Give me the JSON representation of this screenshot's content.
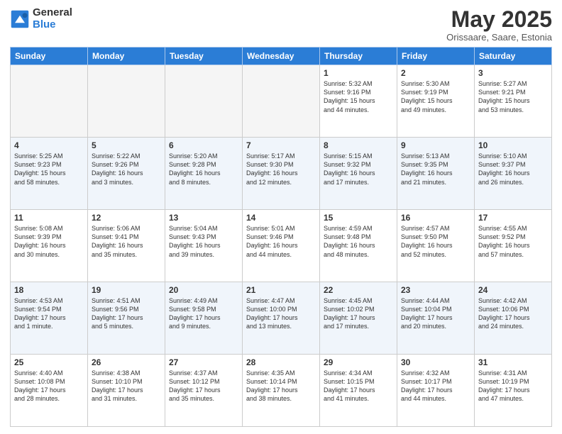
{
  "logo": {
    "general": "General",
    "blue": "Blue"
  },
  "title": "May 2025",
  "subtitle": "Orissaare, Saare, Estonia",
  "headers": [
    "Sunday",
    "Monday",
    "Tuesday",
    "Wednesday",
    "Thursday",
    "Friday",
    "Saturday"
  ],
  "weeks": [
    [
      {
        "day": "",
        "info": ""
      },
      {
        "day": "",
        "info": ""
      },
      {
        "day": "",
        "info": ""
      },
      {
        "day": "",
        "info": ""
      },
      {
        "day": "1",
        "info": "Sunrise: 5:32 AM\nSunset: 9:16 PM\nDaylight: 15 hours\nand 44 minutes."
      },
      {
        "day": "2",
        "info": "Sunrise: 5:30 AM\nSunset: 9:19 PM\nDaylight: 15 hours\nand 49 minutes."
      },
      {
        "day": "3",
        "info": "Sunrise: 5:27 AM\nSunset: 9:21 PM\nDaylight: 15 hours\nand 53 minutes."
      }
    ],
    [
      {
        "day": "4",
        "info": "Sunrise: 5:25 AM\nSunset: 9:23 PM\nDaylight: 15 hours\nand 58 minutes."
      },
      {
        "day": "5",
        "info": "Sunrise: 5:22 AM\nSunset: 9:26 PM\nDaylight: 16 hours\nand 3 minutes."
      },
      {
        "day": "6",
        "info": "Sunrise: 5:20 AM\nSunset: 9:28 PM\nDaylight: 16 hours\nand 8 minutes."
      },
      {
        "day": "7",
        "info": "Sunrise: 5:17 AM\nSunset: 9:30 PM\nDaylight: 16 hours\nand 12 minutes."
      },
      {
        "day": "8",
        "info": "Sunrise: 5:15 AM\nSunset: 9:32 PM\nDaylight: 16 hours\nand 17 minutes."
      },
      {
        "day": "9",
        "info": "Sunrise: 5:13 AM\nSunset: 9:35 PM\nDaylight: 16 hours\nand 21 minutes."
      },
      {
        "day": "10",
        "info": "Sunrise: 5:10 AM\nSunset: 9:37 PM\nDaylight: 16 hours\nand 26 minutes."
      }
    ],
    [
      {
        "day": "11",
        "info": "Sunrise: 5:08 AM\nSunset: 9:39 PM\nDaylight: 16 hours\nand 30 minutes."
      },
      {
        "day": "12",
        "info": "Sunrise: 5:06 AM\nSunset: 9:41 PM\nDaylight: 16 hours\nand 35 minutes."
      },
      {
        "day": "13",
        "info": "Sunrise: 5:04 AM\nSunset: 9:43 PM\nDaylight: 16 hours\nand 39 minutes."
      },
      {
        "day": "14",
        "info": "Sunrise: 5:01 AM\nSunset: 9:46 PM\nDaylight: 16 hours\nand 44 minutes."
      },
      {
        "day": "15",
        "info": "Sunrise: 4:59 AM\nSunset: 9:48 PM\nDaylight: 16 hours\nand 48 minutes."
      },
      {
        "day": "16",
        "info": "Sunrise: 4:57 AM\nSunset: 9:50 PM\nDaylight: 16 hours\nand 52 minutes."
      },
      {
        "day": "17",
        "info": "Sunrise: 4:55 AM\nSunset: 9:52 PM\nDaylight: 16 hours\nand 57 minutes."
      }
    ],
    [
      {
        "day": "18",
        "info": "Sunrise: 4:53 AM\nSunset: 9:54 PM\nDaylight: 17 hours\nand 1 minute."
      },
      {
        "day": "19",
        "info": "Sunrise: 4:51 AM\nSunset: 9:56 PM\nDaylight: 17 hours\nand 5 minutes."
      },
      {
        "day": "20",
        "info": "Sunrise: 4:49 AM\nSunset: 9:58 PM\nDaylight: 17 hours\nand 9 minutes."
      },
      {
        "day": "21",
        "info": "Sunrise: 4:47 AM\nSunset: 10:00 PM\nDaylight: 17 hours\nand 13 minutes."
      },
      {
        "day": "22",
        "info": "Sunrise: 4:45 AM\nSunset: 10:02 PM\nDaylight: 17 hours\nand 17 minutes."
      },
      {
        "day": "23",
        "info": "Sunrise: 4:44 AM\nSunset: 10:04 PM\nDaylight: 17 hours\nand 20 minutes."
      },
      {
        "day": "24",
        "info": "Sunrise: 4:42 AM\nSunset: 10:06 PM\nDaylight: 17 hours\nand 24 minutes."
      }
    ],
    [
      {
        "day": "25",
        "info": "Sunrise: 4:40 AM\nSunset: 10:08 PM\nDaylight: 17 hours\nand 28 minutes."
      },
      {
        "day": "26",
        "info": "Sunrise: 4:38 AM\nSunset: 10:10 PM\nDaylight: 17 hours\nand 31 minutes."
      },
      {
        "day": "27",
        "info": "Sunrise: 4:37 AM\nSunset: 10:12 PM\nDaylight: 17 hours\nand 35 minutes."
      },
      {
        "day": "28",
        "info": "Sunrise: 4:35 AM\nSunset: 10:14 PM\nDaylight: 17 hours\nand 38 minutes."
      },
      {
        "day": "29",
        "info": "Sunrise: 4:34 AM\nSunset: 10:15 PM\nDaylight: 17 hours\nand 41 minutes."
      },
      {
        "day": "30",
        "info": "Sunrise: 4:32 AM\nSunset: 10:17 PM\nDaylight: 17 hours\nand 44 minutes."
      },
      {
        "day": "31",
        "info": "Sunrise: 4:31 AM\nSunset: 10:19 PM\nDaylight: 17 hours\nand 47 minutes."
      }
    ]
  ]
}
